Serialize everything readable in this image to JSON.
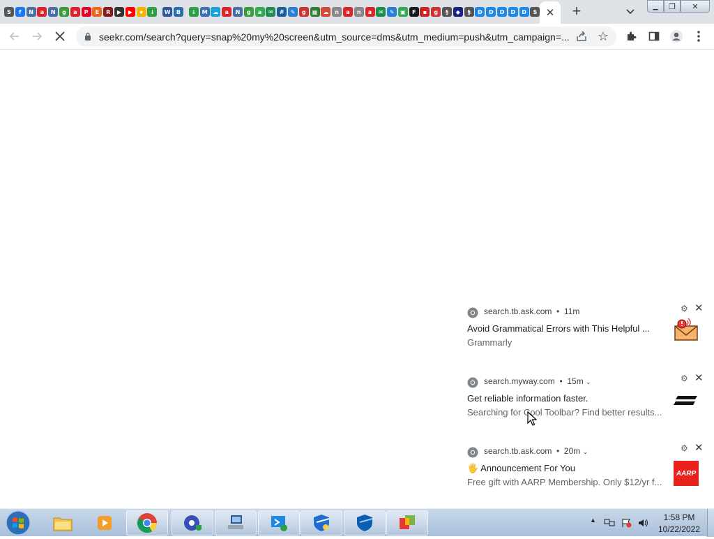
{
  "tabstrip": {
    "pinned_favicons": [
      {
        "icon": "seekr-icon",
        "color": "#555555",
        "glyph": "S"
      },
      {
        "icon": "facebook-icon",
        "color": "#1877f2",
        "glyph": "f"
      },
      {
        "icon": "news-icon",
        "color": "#4a6fa5",
        "glyph": "N"
      },
      {
        "icon": "ask-icon",
        "color": "#d8262c",
        "glyph": "a"
      },
      {
        "icon": "news-icon",
        "color": "#4a6fa5",
        "glyph": "N"
      },
      {
        "icon": "game-icon",
        "color": "#3a9d3a",
        "glyph": "g"
      },
      {
        "icon": "ask-icon",
        "color": "#d8262c",
        "glyph": "a"
      },
      {
        "icon": "pinterest-icon",
        "color": "#e60023",
        "glyph": "P"
      },
      {
        "icon": "etsy-icon",
        "color": "#f1641e",
        "glyph": "E"
      },
      {
        "icon": "recipe-icon",
        "color": "#8b1a1a",
        "glyph": "R"
      },
      {
        "icon": "clapper-icon",
        "color": "#333333",
        "glyph": "▶"
      },
      {
        "icon": "youtube-icon",
        "color": "#ff0000",
        "glyph": "▶"
      },
      {
        "icon": "bookmark-icon",
        "color": "#f4b400",
        "glyph": "★"
      },
      {
        "icon": "download-icon",
        "color": "#2e9e47",
        "glyph": "↓"
      },
      {
        "gap": true
      },
      {
        "icon": "word-icon",
        "color": "#2b579a",
        "glyph": "W"
      },
      {
        "icon": "bookmark-icon",
        "color": "#2b6cb0",
        "glyph": "B"
      },
      {
        "gap": true
      },
      {
        "icon": "download-icon",
        "color": "#2e9e47",
        "glyph": "↓"
      },
      {
        "icon": "map-icon",
        "color": "#3d6fb6",
        "glyph": "M"
      },
      {
        "icon": "weather-icon",
        "color": "#1aa1d6",
        "glyph": "☁"
      },
      {
        "icon": "ask-icon",
        "color": "#d8262c",
        "glyph": "a"
      },
      {
        "icon": "news-icon",
        "color": "#4a6fa5",
        "glyph": "N"
      },
      {
        "icon": "game-icon",
        "color": "#3a9d3a",
        "glyph": "g"
      },
      {
        "icon": "translate-icon",
        "color": "#34a853",
        "glyph": "a"
      },
      {
        "icon": "email-icon",
        "color": "#1c8f4f",
        "glyph": "✉"
      },
      {
        "icon": "calculator-icon",
        "color": "#1b5e9b",
        "glyph": "#"
      },
      {
        "icon": "pen-icon",
        "color": "#2a7fd4",
        "glyph": "✎"
      },
      {
        "icon": "game-icon",
        "color": "#cc3333",
        "glyph": "g"
      },
      {
        "icon": "grid-icon",
        "color": "#2e7d32",
        "glyph": "▦"
      },
      {
        "icon": "cloud-icon",
        "color": "#d04a37",
        "glyph": "☁"
      },
      {
        "icon": "news-icon",
        "color": "#888888",
        "glyph": "n"
      },
      {
        "icon": "ask-icon",
        "color": "#d8262c",
        "glyph": "a"
      },
      {
        "icon": "news-icon",
        "color": "#888888",
        "glyph": "n"
      },
      {
        "icon": "ask-icon",
        "color": "#d8262c",
        "glyph": "a"
      },
      {
        "icon": "email-icon",
        "color": "#1c8f4f",
        "glyph": "✉"
      },
      {
        "icon": "pen-icon",
        "color": "#2a7fd4",
        "glyph": "✎"
      },
      {
        "icon": "card-icon",
        "color": "#34a853",
        "glyph": "▣"
      },
      {
        "icon": "letter-f-icon",
        "color": "#1a1a1a",
        "glyph": "F"
      },
      {
        "icon": "box-icon",
        "color": "#c62828",
        "glyph": "▪"
      },
      {
        "icon": "game-icon",
        "color": "#cc3333",
        "glyph": "g"
      },
      {
        "icon": "scroll-icon",
        "color": "#555555",
        "glyph": "§"
      },
      {
        "icon": "tool-icon",
        "color": "#1a237e",
        "glyph": "◆"
      },
      {
        "icon": "scroll-icon",
        "color": "#555555",
        "glyph": "§"
      },
      {
        "icon": "search-icon",
        "color": "#1e88e5",
        "glyph": "D"
      },
      {
        "icon": "search-icon",
        "color": "#1e88e5",
        "glyph": "D"
      },
      {
        "icon": "search-icon",
        "color": "#1e88e5",
        "glyph": "D"
      },
      {
        "icon": "search-icon",
        "color": "#1e88e5",
        "glyph": "D"
      },
      {
        "icon": "search-icon",
        "color": "#1e88e5",
        "glyph": "D"
      },
      {
        "icon": "seekr-icon",
        "color": "#555555",
        "glyph": "S"
      }
    ],
    "active_tab_close": "✕",
    "new_tab": "+",
    "tab_search": "⌄"
  },
  "window_controls": {
    "minimize": "▁",
    "restore": "❐",
    "close": "✕"
  },
  "toolbar": {
    "url": "seekr.com/search?query=snap%20my%20screen&utm_source=dms&utm_medium=push&utm_campaign=..."
  },
  "notifications": [
    {
      "source": "search.tb.ask.com",
      "time": "11m",
      "title": "Avoid Grammatical Errors with This Helpful ...",
      "body": "Grammarly",
      "image": "envelope-alert-icon",
      "expandable": false
    },
    {
      "source": "search.myway.com",
      "time": "15m",
      "title": "Get reliable information faster.",
      "body": "Searching for Cool Toolbar? Find better results...",
      "image": "stripes-logo-icon",
      "expandable": true
    },
    {
      "source": "search.tb.ask.com",
      "time": "20m",
      "title": "🖐 Announcement For You",
      "body": "Free gift with AARP Membership. Only $12/yr f...",
      "image": "aarp-logo",
      "image_text": "AARP",
      "expandable": true
    }
  ],
  "taskbar": {
    "items": [
      {
        "name": "explorer-icon"
      },
      {
        "name": "media-player-icon"
      },
      {
        "name": "chrome-icon"
      },
      {
        "name": "settings-shield-icon"
      },
      {
        "name": "network-computer-icon"
      },
      {
        "name": "remote-desktop-icon"
      },
      {
        "name": "security-shield-icon"
      },
      {
        "name": "security-shield-blue-icon"
      },
      {
        "name": "colorful-app-icon"
      }
    ],
    "clock_time": "1:58 PM",
    "clock_date": "10/22/2022"
  }
}
